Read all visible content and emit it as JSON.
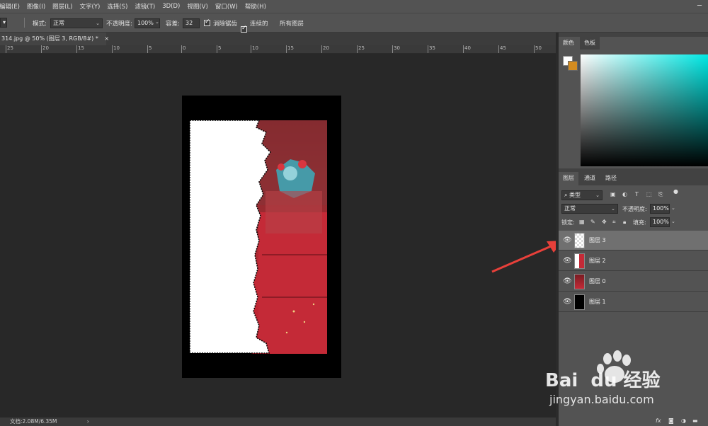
{
  "menu": [
    "编辑(E)",
    "图像(I)",
    "图层(L)",
    "文字(Y)",
    "选择(S)",
    "滤镜(T)",
    "3D(D)",
    "视图(V)",
    "窗口(W)",
    "帮助(H)"
  ],
  "options": {
    "mode_label": "模式:",
    "mode_value": "正常",
    "opacity_label": "不透明度:",
    "opacity_value": "100%",
    "tolerance_label": "容差:",
    "tolerance_value": "32",
    "antialias_label": "消除锯齿",
    "contiguous_label": "连续的",
    "all_layers_label": "所有图层"
  },
  "document": {
    "tab_title": "314.jpg @ 50% (图层 3, RGB/8#) *",
    "close": "×"
  },
  "ruler": [
    "25",
    "20",
    "15",
    "10",
    "5",
    "0",
    "5",
    "10",
    "15",
    "20",
    "25",
    "30",
    "35",
    "40",
    "45",
    "50"
  ],
  "status": {
    "doc_info": "文档:2.08M/6.35M"
  },
  "color_panel": {
    "tabs": [
      "颜色",
      "色板"
    ],
    "fg_color": "#ffffff",
    "bg_color": "#d48c1f"
  },
  "layers_panel": {
    "tabs": [
      "图层",
      "通道",
      "路径"
    ],
    "filter_kind": "类型",
    "blend_mode": "正常",
    "opacity_label": "不透明度:",
    "opacity_value": "100%",
    "lock_label": "锁定:",
    "fill_label": "填充:",
    "fill_value": "100%",
    "layers": [
      {
        "name": "图层 3",
        "selected": true
      },
      {
        "name": "图层 2",
        "selected": false
      },
      {
        "name": "图层 0",
        "selected": false
      },
      {
        "name": "图层 1",
        "selected": false
      }
    ],
    "footer_fx": "fx"
  },
  "watermark": {
    "brand": "Bai  du 经验",
    "url": "jingyan.baidu.com"
  },
  "colors": {
    "accent_arrow": "#e8403a"
  }
}
